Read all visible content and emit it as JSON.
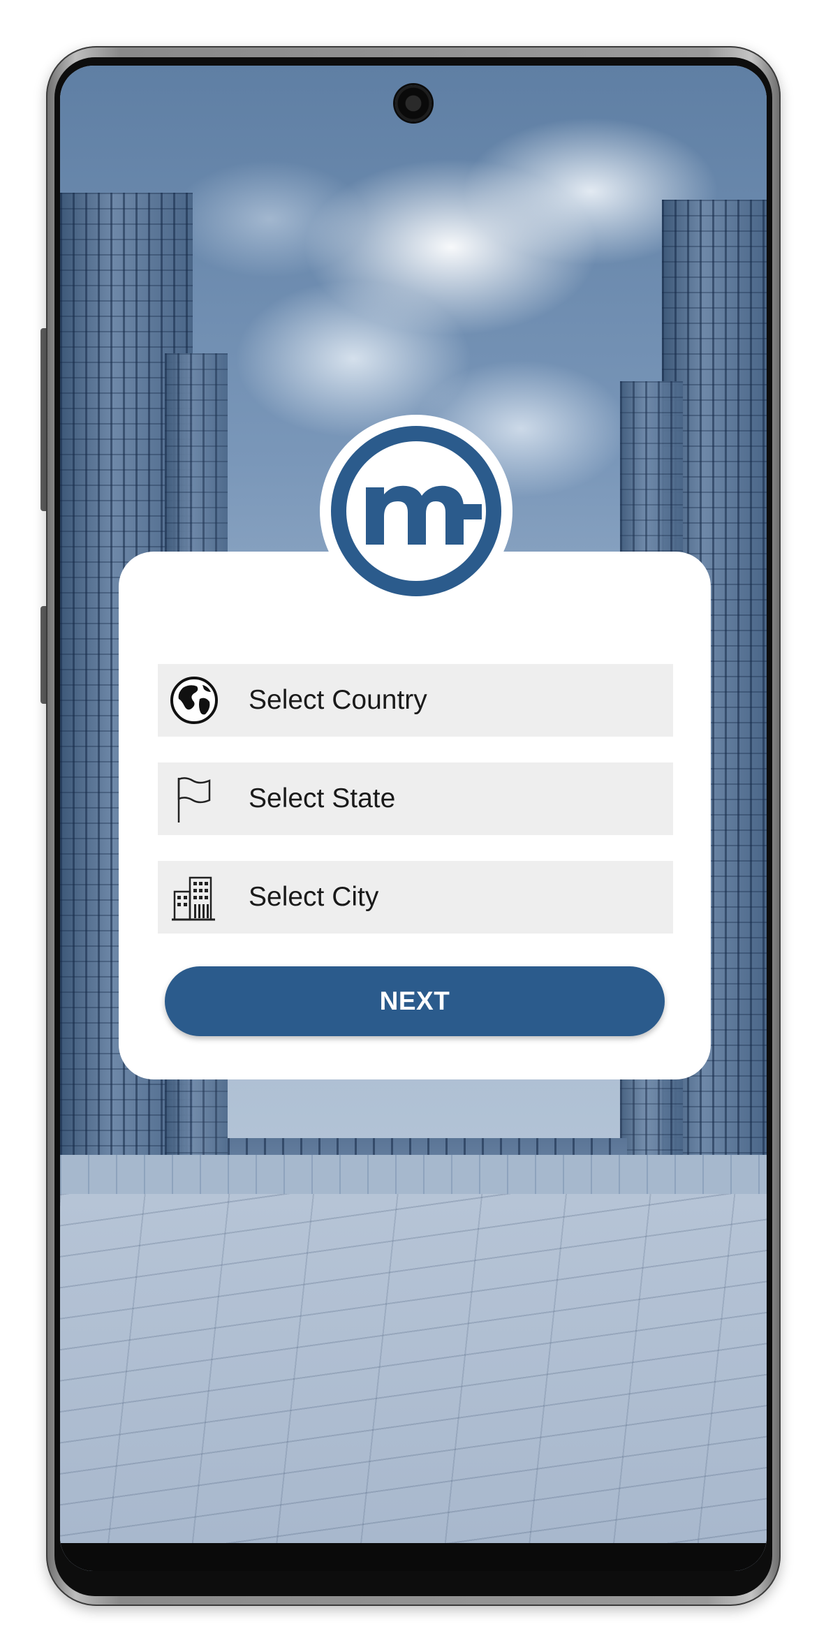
{
  "app": {
    "logo_letter": "m",
    "brand_color": "#2b5b8c"
  },
  "form": {
    "country": {
      "placeholder": "Select Country",
      "icon": "globe-icon"
    },
    "state": {
      "placeholder": "Select State",
      "icon": "flag-icon"
    },
    "city": {
      "placeholder": "Select City",
      "icon": "city-buildings-icon"
    }
  },
  "actions": {
    "next_label": "NEXT"
  }
}
